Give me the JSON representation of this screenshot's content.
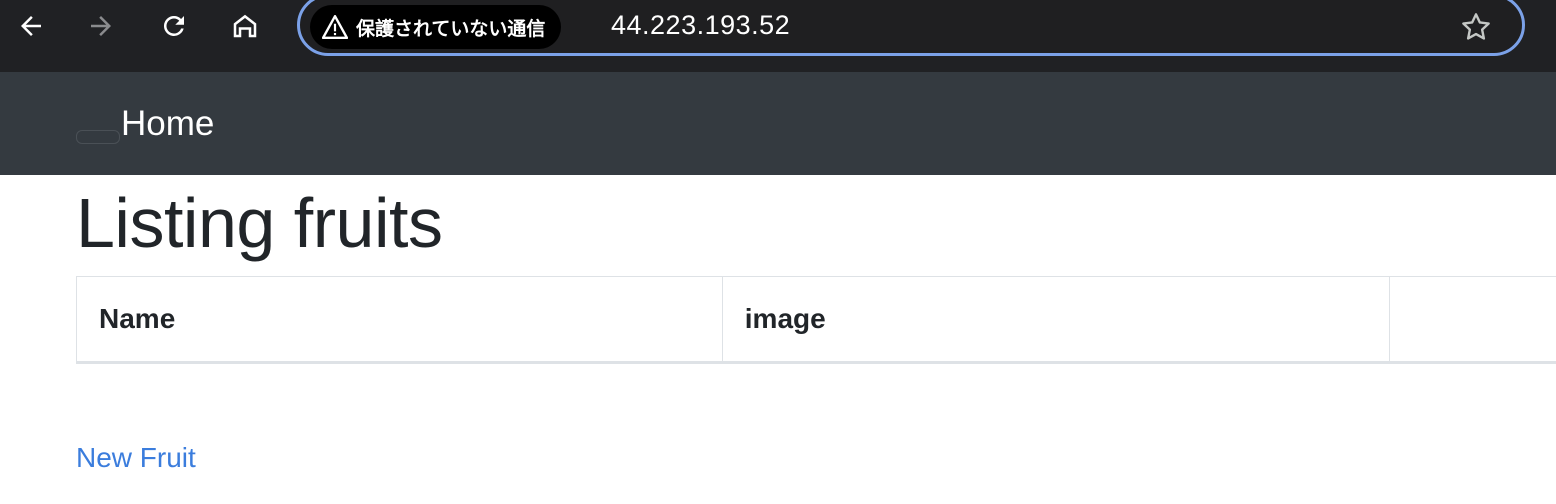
{
  "browser": {
    "security_label": "保護されていない通信",
    "url": "44.223.193.52",
    "colors": {
      "toolbar_bg": "#202124",
      "omnibox_border": "#7ba1e8",
      "icon": "#ffffff",
      "icon_disabled": "#8a8b8e"
    },
    "icons": [
      "back-arrow-icon",
      "forward-arrow-icon",
      "reload-icon",
      "home-icon",
      "warning-icon",
      "star-icon"
    ]
  },
  "navbar": {
    "brand": "Home",
    "bg_color": "#343a40"
  },
  "page": {
    "title": "Listing fruits",
    "table": {
      "headers": [
        "Name",
        "image",
        ""
      ],
      "rows": []
    },
    "new_link": "New Fruit",
    "link_color": "#3b7ddd"
  }
}
